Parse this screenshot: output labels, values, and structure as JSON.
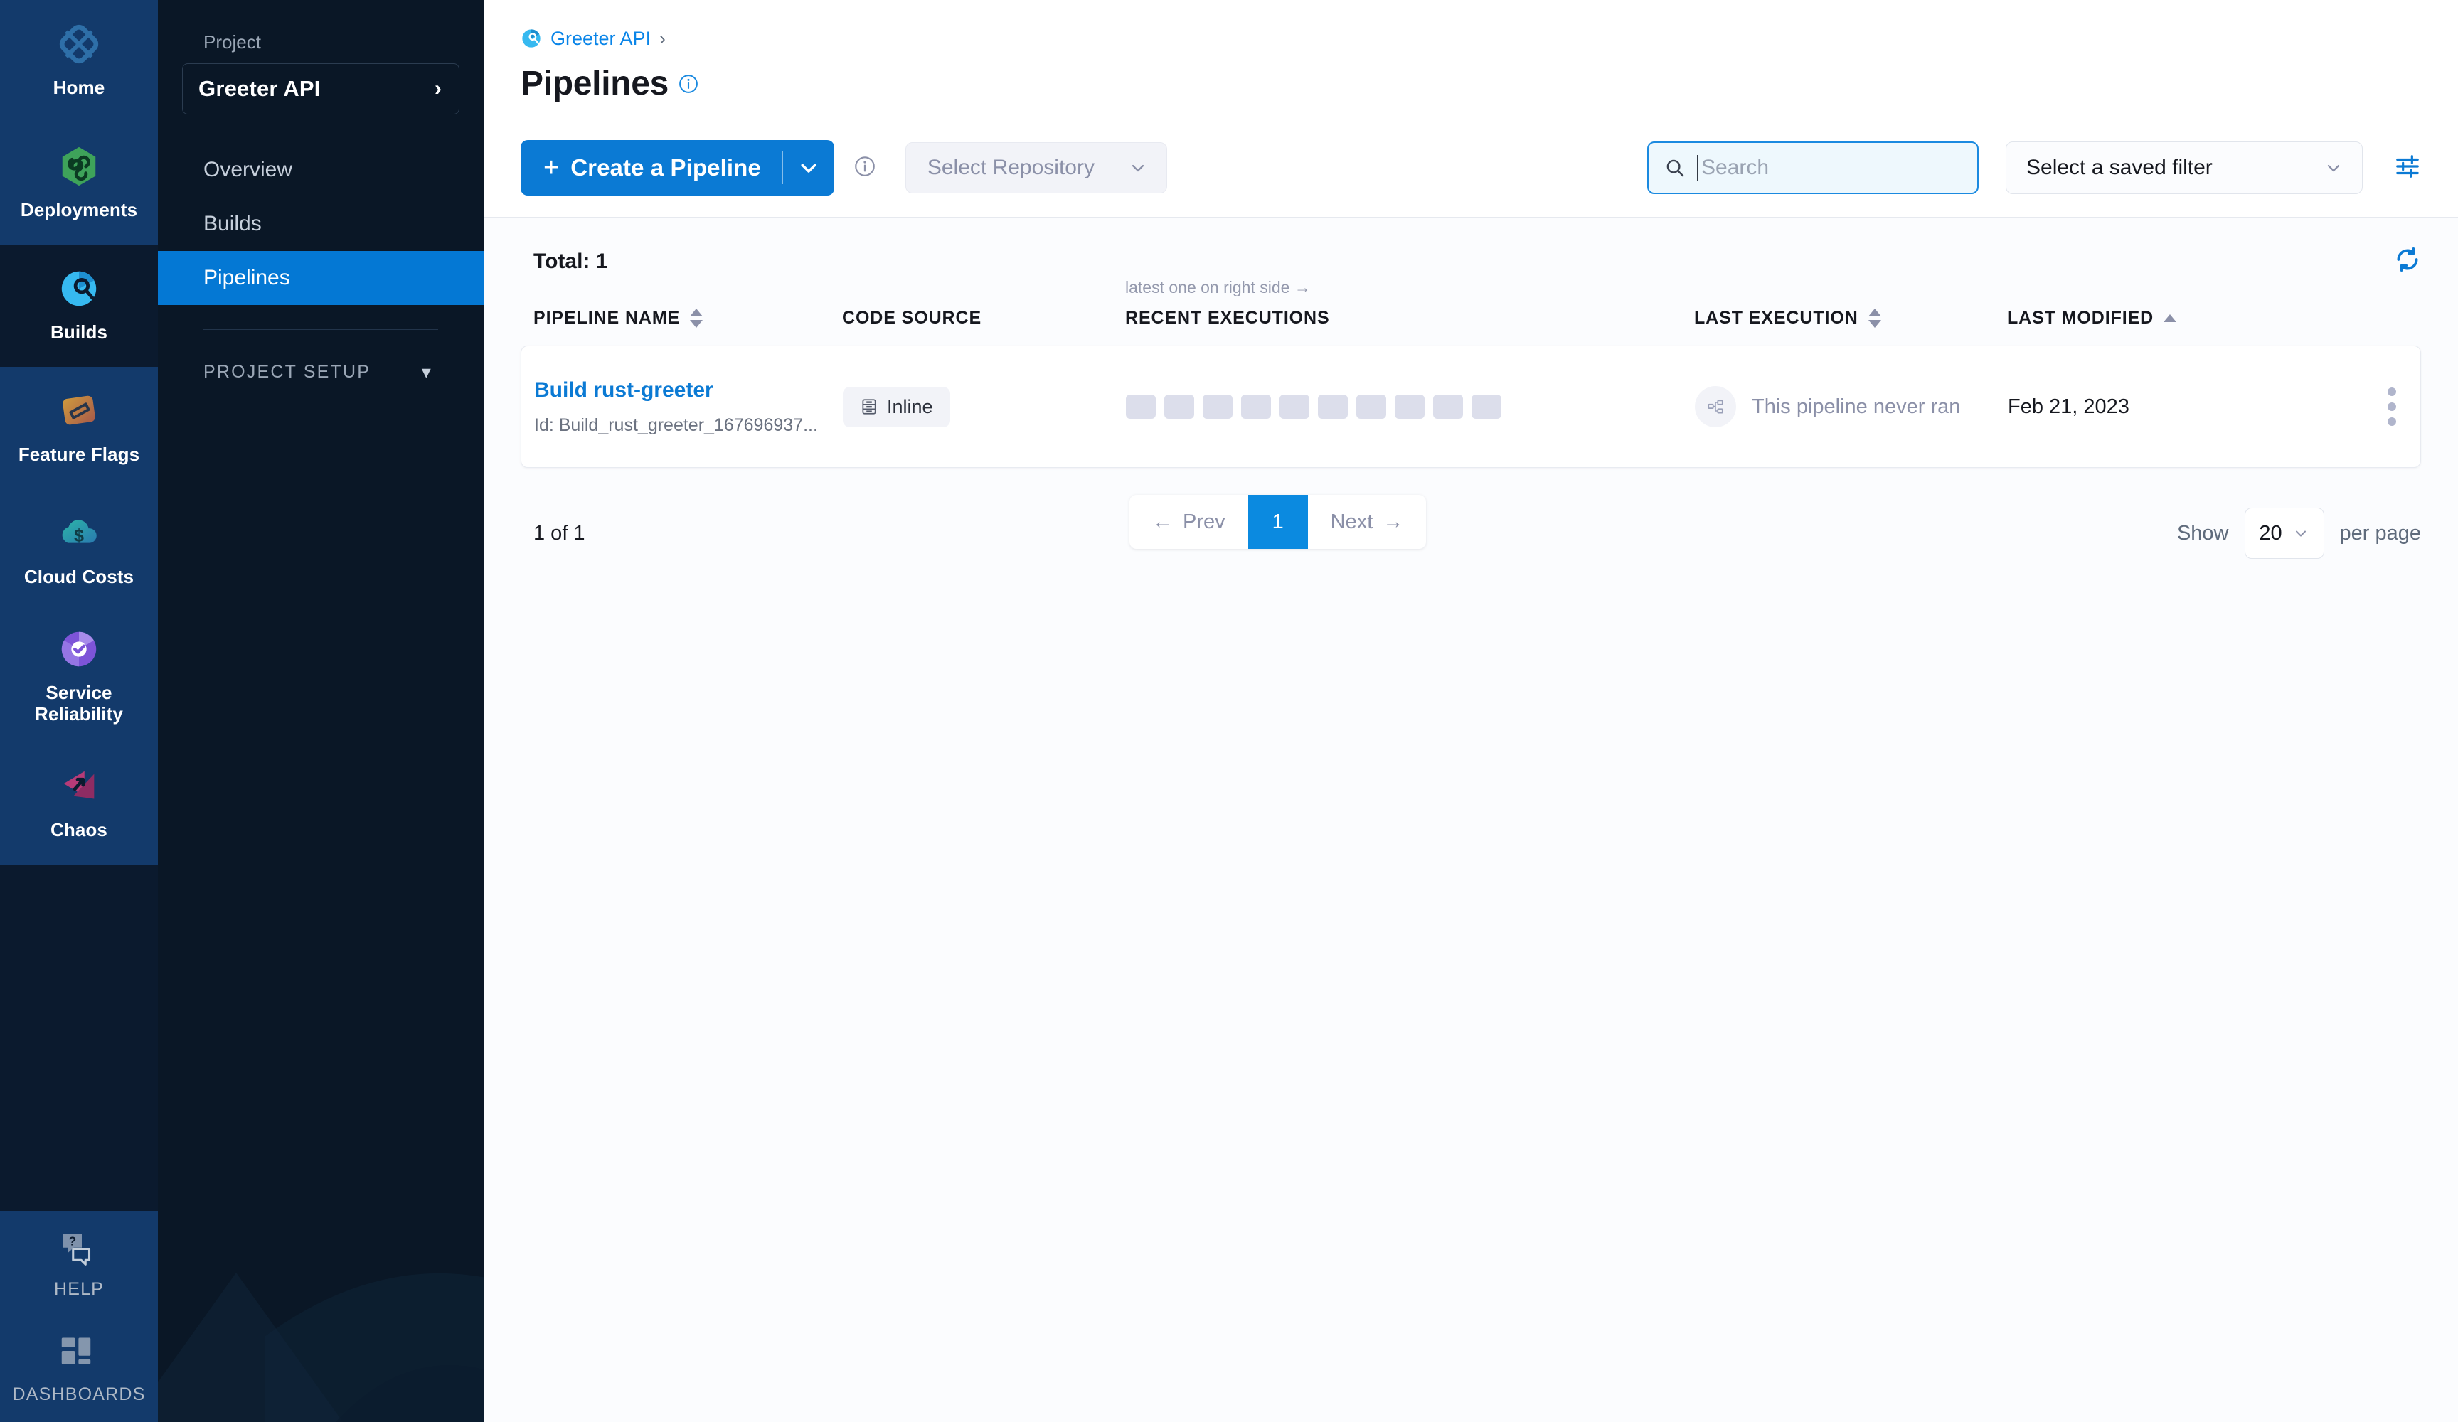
{
  "rail": {
    "items": [
      {
        "label": "Home",
        "icon": "home-diamond-icon",
        "active": true
      },
      {
        "label": "Deployments",
        "icon": "deployments-infinity-icon",
        "active": true
      },
      {
        "label": "Builds",
        "icon": "builds-icon",
        "active": false
      },
      {
        "label": "Feature Flags",
        "icon": "feature-flags-icon",
        "active": true
      },
      {
        "label": "Cloud Costs",
        "icon": "cloud-costs-icon",
        "active": true
      },
      {
        "label": "Service Reliability",
        "icon": "service-reliability-icon",
        "active": true
      },
      {
        "label": "Chaos",
        "icon": "chaos-icon",
        "active": true
      }
    ],
    "bottom": [
      {
        "label": "HELP",
        "icon": "help-icon"
      },
      {
        "label": "DASHBOARDS",
        "icon": "dashboards-icon"
      }
    ]
  },
  "project_nav": {
    "label": "Project",
    "selected_project": "Greeter API",
    "items": [
      {
        "label": "Overview",
        "active": false
      },
      {
        "label": "Builds",
        "active": false
      },
      {
        "label": "Pipelines",
        "active": true
      }
    ],
    "section": "PROJECT SETUP"
  },
  "header": {
    "breadcrumb_project": "Greeter API",
    "breadcrumb_separator": "›",
    "title": "Pipelines"
  },
  "toolbar": {
    "create_label": "Create a Pipeline",
    "create_plus": "+",
    "select_repository": "Select Repository",
    "search_placeholder": "Search",
    "search_value": "",
    "saved_filter": "Select a saved filter"
  },
  "list": {
    "total_label": "Total: 1",
    "recent_hint": "latest one on right side →",
    "columns": [
      {
        "key": "name",
        "label": "PIPELINE NAME",
        "sort": "both"
      },
      {
        "key": "source",
        "label": "CODE SOURCE",
        "sort": "none"
      },
      {
        "key": "recent",
        "label": "RECENT EXECUTIONS",
        "sort": "none"
      },
      {
        "key": "lastexec",
        "label": "LAST EXECUTION",
        "sort": "both"
      },
      {
        "key": "lastmod",
        "label": "LAST MODIFIED",
        "sort": "asc"
      }
    ],
    "rows": [
      {
        "name": "Build rust-greeter",
        "id": "Id: Build_rust_greeter_167696937...",
        "code_source": "Inline",
        "code_source_icon": "inline-stack-icon",
        "recent_executions": [
          "empty",
          "empty",
          "empty",
          "empty",
          "empty",
          "empty",
          "empty",
          "empty",
          "empty",
          "empty"
        ],
        "last_execution": "This pipeline never ran",
        "last_modified": "Feb 21, 2023"
      }
    ]
  },
  "pagination": {
    "count_label": "1 of 1",
    "prev_label": "Prev",
    "prev_arrow": "←",
    "next_label": "Next",
    "next_arrow": "→",
    "current_page": "1",
    "show_label": "Show",
    "per_page_value": "20",
    "per_page_label": "per page"
  },
  "colors": {
    "accent_blue": "#0b7ad4",
    "rail_active": "#133a6b",
    "rail_dark": "#0b1a2e",
    "project_nav_bg": "#0a1726",
    "link_blue": "#0a85e8",
    "muted": "#8b90a8"
  }
}
